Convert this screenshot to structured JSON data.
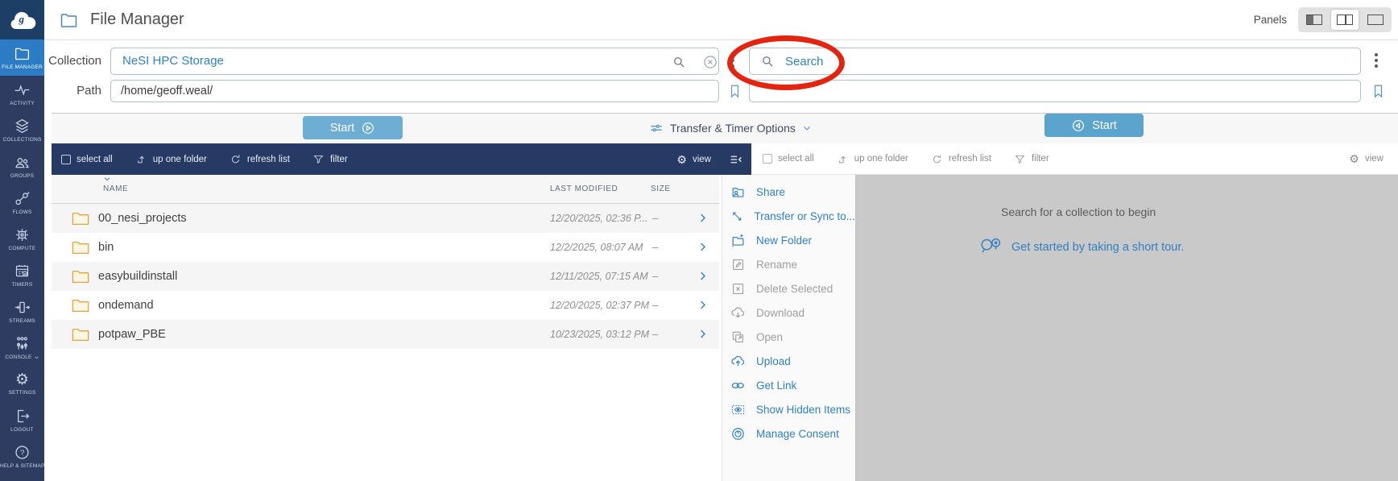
{
  "icons": {
    "gear": "⚙"
  },
  "topbar": {
    "title": "File Manager",
    "panels_label": "Panels"
  },
  "sidebar": {
    "items": [
      {
        "label": "FILE MANAGER",
        "active": true
      },
      {
        "label": "ACTIVITY"
      },
      {
        "label": "COLLECTIONS"
      },
      {
        "label": "GROUPS"
      },
      {
        "label": "FLOWS"
      },
      {
        "label": "COMPUTE"
      },
      {
        "label": "TIMERS"
      },
      {
        "label": "STREAMS"
      },
      {
        "label": "CONSOLE"
      },
      {
        "label": "SETTINGS"
      },
      {
        "label": "LOGOUT"
      },
      {
        "label": "HELP & SITEMAP"
      }
    ]
  },
  "left_panel": {
    "collection_label": "Collection",
    "collection_value": "NeSI HPC Storage",
    "path_label": "Path",
    "path_value": "/home/geoff.weal/",
    "start_button": "Start",
    "toolbar": {
      "select_all": "select all",
      "up_one_folder": "up one folder",
      "refresh_list": "refresh list",
      "filter": "filter",
      "view": "view"
    },
    "table": {
      "columns": {
        "name": "NAME",
        "modified": "LAST MODIFIED",
        "size": "SIZE"
      },
      "rows": [
        {
          "name": "00_nesi_projects",
          "modified": "12/20/2025, 02:36 P...",
          "size": "–"
        },
        {
          "name": "bin",
          "modified": "12/2/2025, 08:07 AM",
          "size": "–"
        },
        {
          "name": "easybuildinstall",
          "modified": "12/11/2025, 07:15 AM",
          "size": "–"
        },
        {
          "name": "ondemand",
          "modified": "12/20/2025, 02:37 PM",
          "size": "–"
        },
        {
          "name": "potpaw_PBE",
          "modified": "10/23/2025, 03:12 PM",
          "size": "–"
        }
      ]
    }
  },
  "transfer_bar": {
    "options_label": "Transfer & Timer Options"
  },
  "right_panel": {
    "search_placeholder": "Search",
    "start_button": "Start",
    "toolbar": {
      "select_all": "select all",
      "up_one_folder": "up one folder",
      "refresh_list": "refresh list",
      "filter": "filter",
      "view": "view"
    },
    "empty_state": {
      "title": "Search for a collection to begin",
      "tour_link": "Get started by taking a short tour."
    }
  },
  "action_menu": {
    "items": [
      {
        "label": "Share",
        "enabled": true
      },
      {
        "label": "Transfer or Sync to...",
        "enabled": true
      },
      {
        "label": "New Folder",
        "enabled": true
      },
      {
        "label": "Rename",
        "enabled": false
      },
      {
        "label": "Delete Selected",
        "enabled": false
      },
      {
        "label": "Download",
        "enabled": false
      },
      {
        "label": "Open",
        "enabled": false
      },
      {
        "label": "Upload",
        "enabled": true
      },
      {
        "label": "Get Link",
        "enabled": true
      },
      {
        "label": "Show Hidden Items",
        "enabled": true
      },
      {
        "label": "Manage Consent",
        "enabled": true
      }
    ]
  },
  "colors": {
    "accent_blue": "#2f81c2",
    "toolbar_navy": "#263a63",
    "sidebar_navy": "#2e3c62",
    "active_item_blue": "#2b7cc4",
    "start_button_blue": "#5ba4cd",
    "annotation_red": "#e3250f",
    "folder_gold": "#e0a33e",
    "empty_panel_gray": "#c9c9c9"
  }
}
